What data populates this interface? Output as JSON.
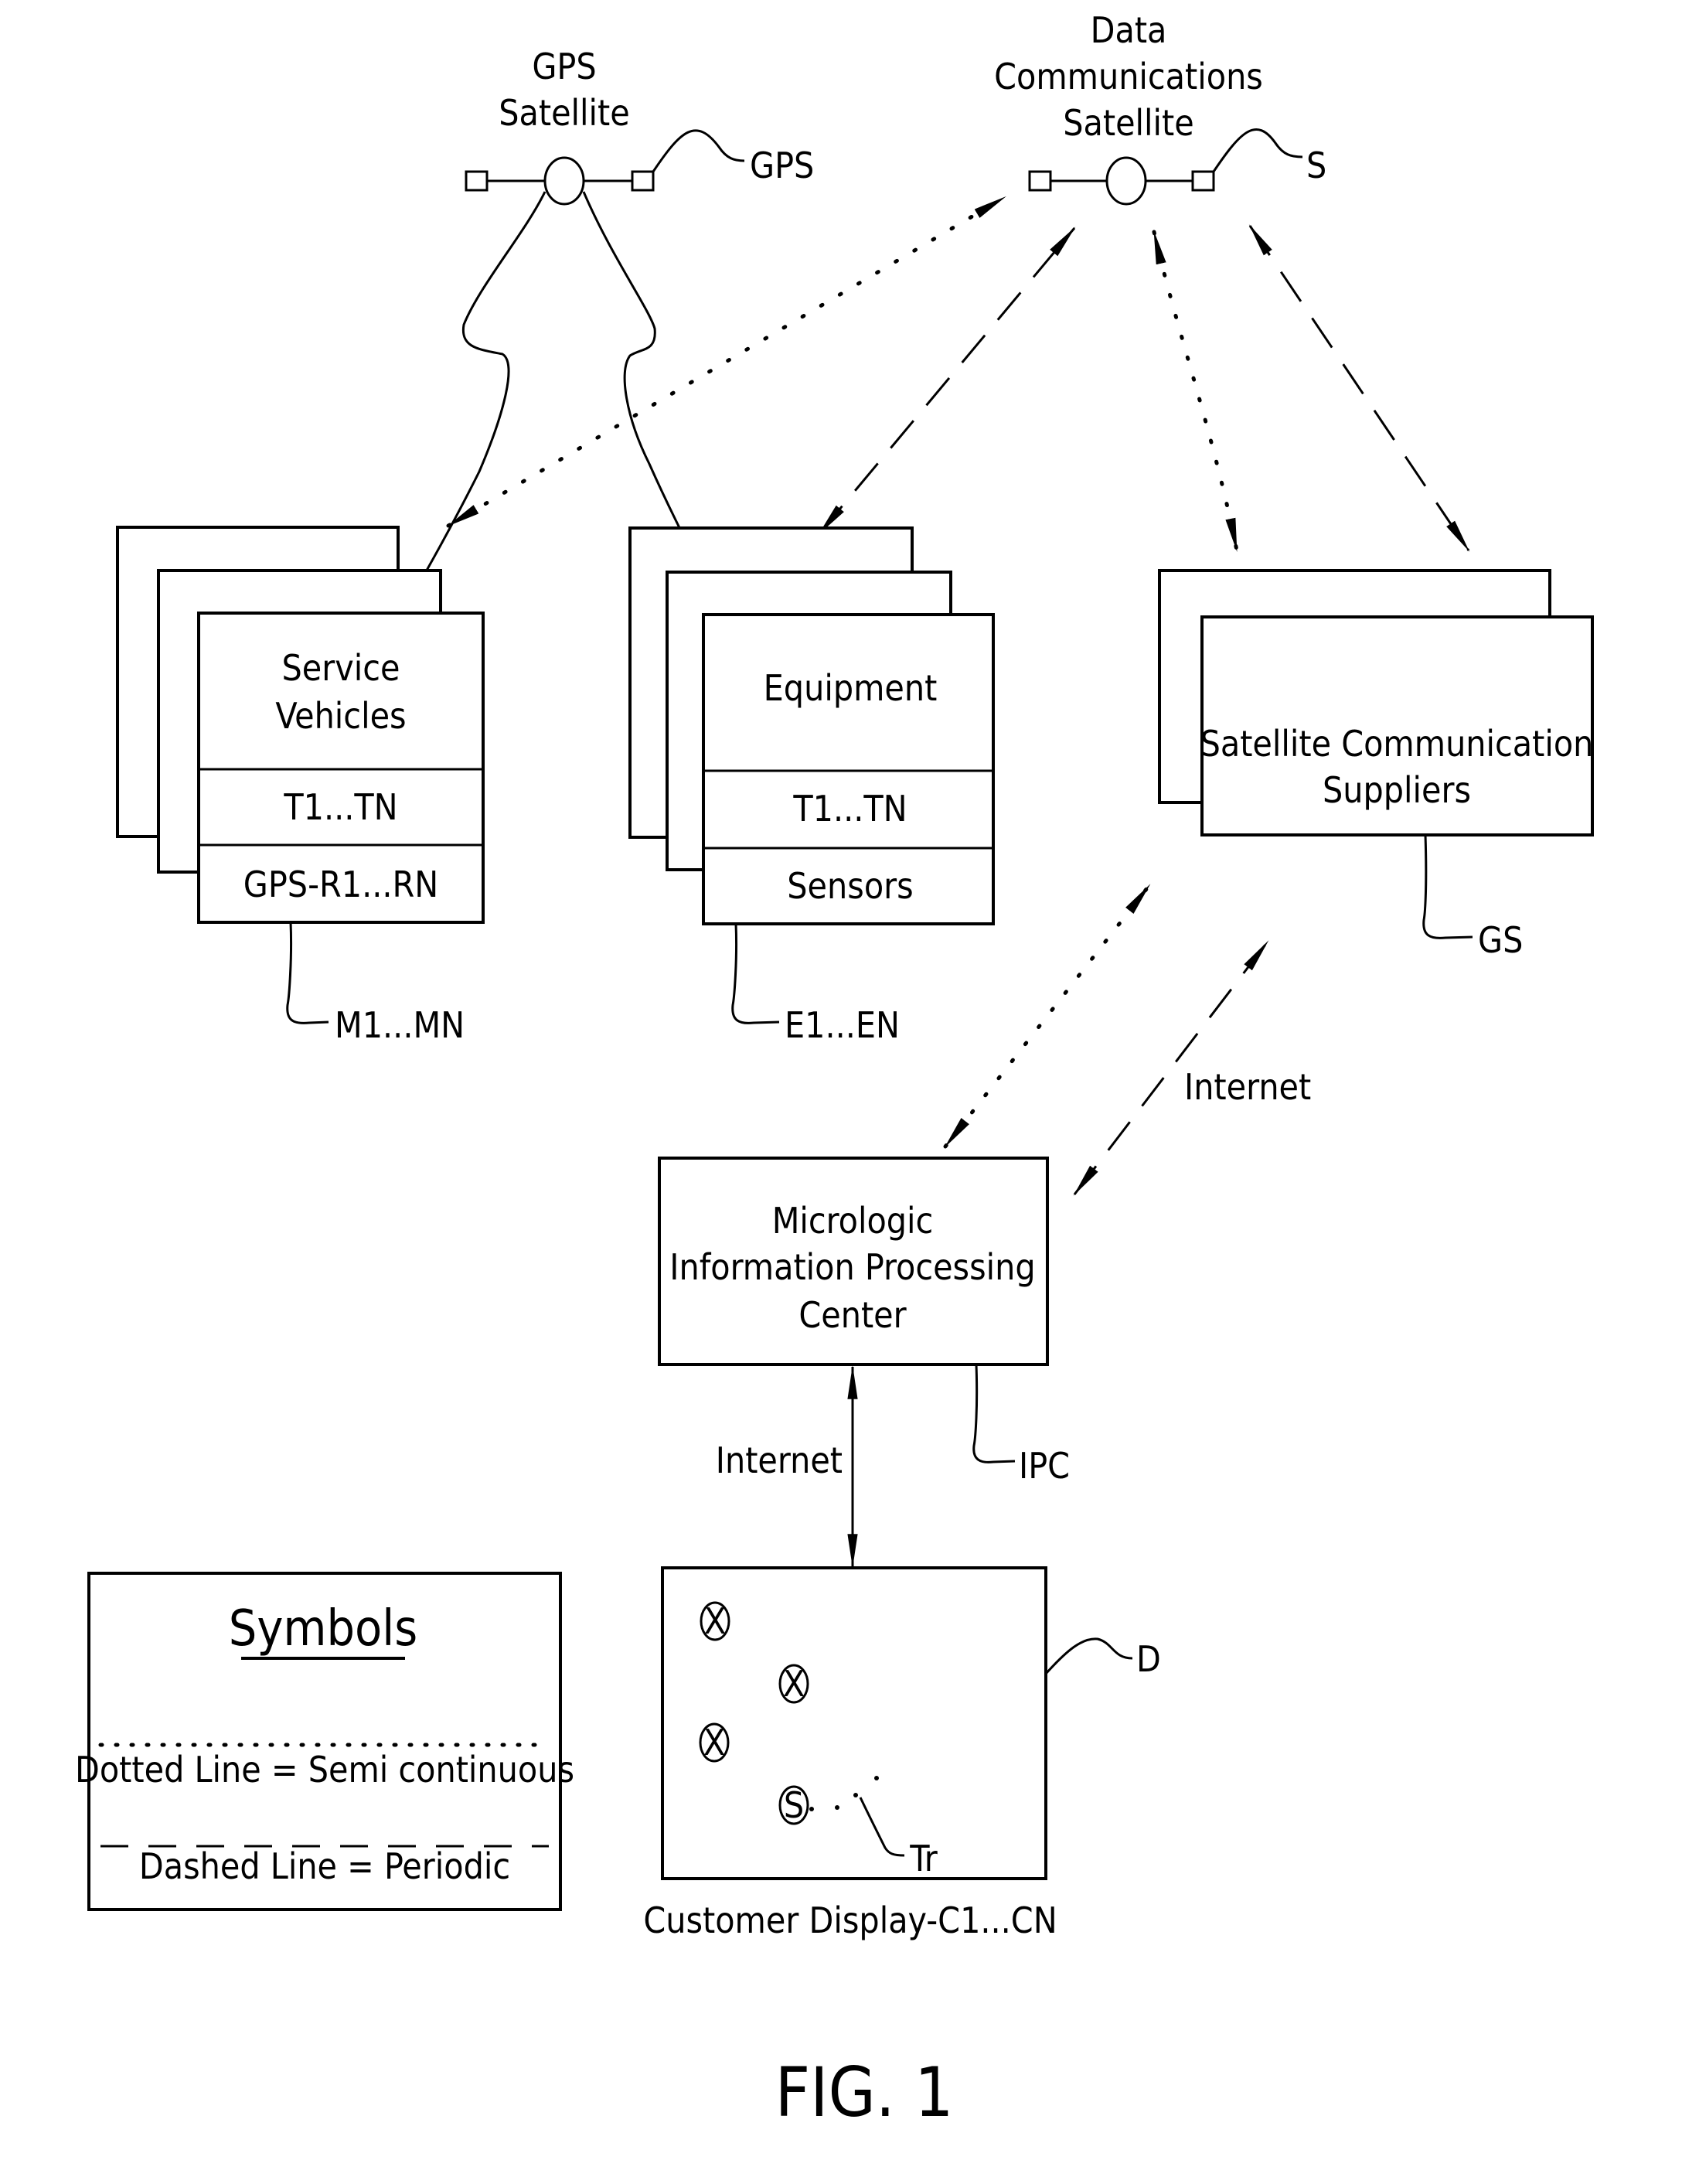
{
  "figure_label": "FIG. 1",
  "satellites": {
    "gps": {
      "title_lines": [
        "GPS",
        "Satellite"
      ],
      "ref": "GPS"
    },
    "data_comm": {
      "title_lines": [
        "Data",
        "Communications",
        "Satellite"
      ],
      "ref": "S"
    }
  },
  "blocks": {
    "service_vehicles": {
      "title_lines": [
        "Service",
        "Vehicles"
      ],
      "rows": [
        "T1...TN",
        "GPS-R1...RN"
      ],
      "ref": "M1...MN"
    },
    "equipment": {
      "title_lines": [
        "Equipment"
      ],
      "rows": [
        "T1...TN",
        "Sensors"
      ],
      "ref": "E1...EN"
    },
    "sat_comm_suppliers": {
      "title_lines": [
        "Satellite  Communication",
        "Suppliers"
      ],
      "ref": "GS"
    },
    "ipc": {
      "title_lines": [
        "Micrologic",
        "Information  Processing",
        "Center"
      ],
      "ref": "IPC"
    },
    "customer_display": {
      "caption": "Customer  Display-C1...CN",
      "markers": [
        "X",
        "X",
        "X",
        "S"
      ],
      "trail_ref": "Tr",
      "ref": "D"
    }
  },
  "links": {
    "gs_ipc_label": "Internet",
    "ipc_display_label": "Internet"
  },
  "legend": {
    "title": "Symbols",
    "dotted_text": "Dotted Line = Semi continuous",
    "dashed_text": "Dashed Line = Periodic"
  }
}
